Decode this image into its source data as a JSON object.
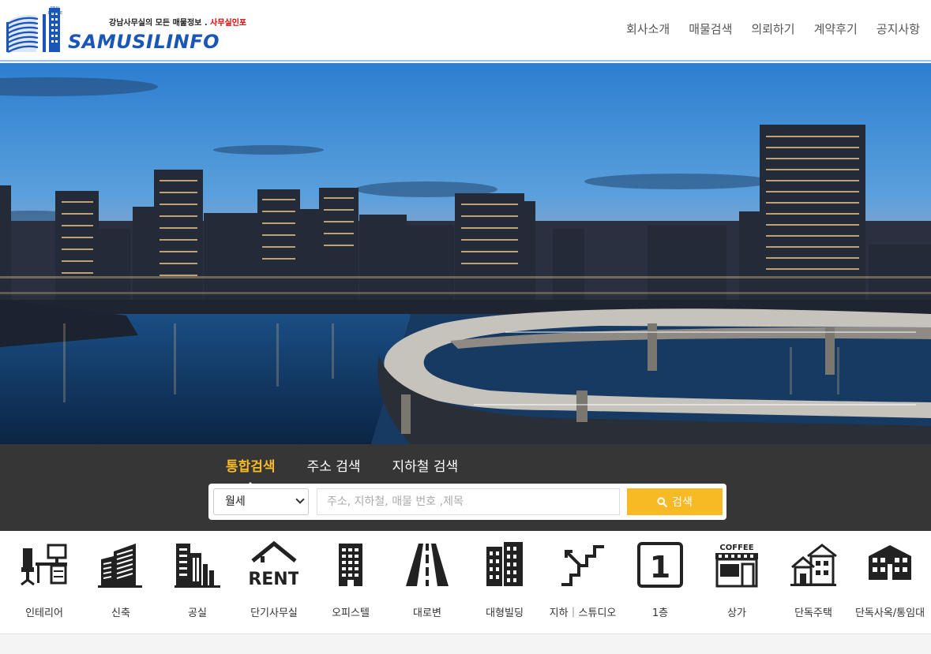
{
  "header": {
    "tagline_main": "강남사무실의 모든 매물정보 . ",
    "tagline_accent": "사무실인포",
    "brand": "SAMUSILINFO",
    "logo_small_text": "REAL ESTATE"
  },
  "nav": [
    {
      "label": "회사소개"
    },
    {
      "label": "매물검색"
    },
    {
      "label": "의뢰하기"
    },
    {
      "label": "계약후기"
    },
    {
      "label": "공지사항"
    }
  ],
  "search": {
    "tabs": [
      {
        "label": "통합검색",
        "active": true
      },
      {
        "label": "주소 검색",
        "active": false
      },
      {
        "label": "지하철 검색",
        "active": false
      }
    ],
    "select_value": "월세",
    "placeholder": "주소, 지하철, 매물 번호 ,제목",
    "button_label": "검색",
    "button_icon": "search-icon"
  },
  "categories": [
    {
      "label": "인테리어",
      "icon": "office-desk-icon"
    },
    {
      "label": "신축",
      "icon": "new-building-icon"
    },
    {
      "label": "공실",
      "icon": "vacant-building-icon"
    },
    {
      "label": "단기사무실",
      "icon": "rent-house-icon",
      "icon_text": "RENT"
    },
    {
      "label": "오피스텔",
      "icon": "officetel-icon"
    },
    {
      "label": "대로변",
      "icon": "road-icon"
    },
    {
      "label": "대형빌딩",
      "icon": "large-building-icon"
    },
    {
      "label": "지하｜스튜디오",
      "icon": "stairs-down-icon"
    },
    {
      "label": "1층",
      "icon": "first-floor-icon",
      "icon_text": "1"
    },
    {
      "label": "상가",
      "icon": "coffee-shop-icon",
      "icon_text": "COFFEE"
    },
    {
      "label": "단독주택",
      "icon": "house-icon"
    },
    {
      "label": "단독사옥/통임대",
      "icon": "whole-building-icon"
    }
  ],
  "colors": {
    "accent": "#f7b924",
    "brand": "#1a56b8",
    "search_bg": "#363636",
    "tagline_accent": "#e00000"
  }
}
